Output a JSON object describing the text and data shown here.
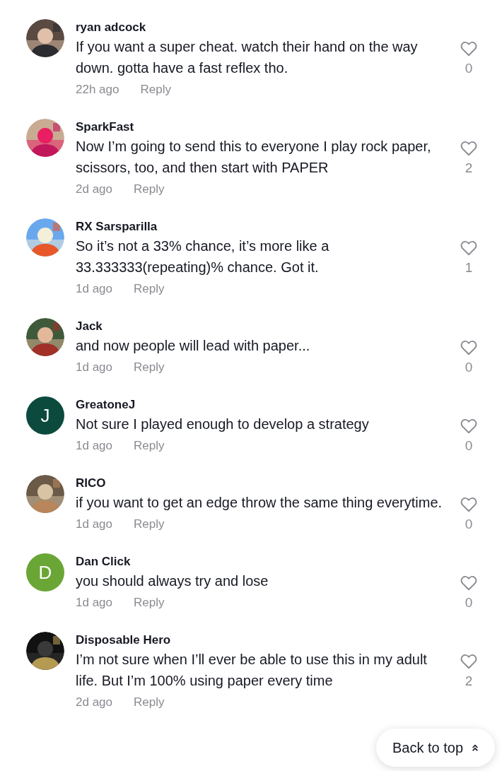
{
  "comments": [
    {
      "name": "ryan adcock",
      "text": "If you want a super cheat. watch their hand on the way down. gotta have a fast reflex tho.",
      "time": "22h ago",
      "reply": "Reply",
      "likes": "0",
      "liked": false
    },
    {
      "name": "SparkFast",
      "text": "Now I’m going to send this to everyone I play rock paper, scissors, too, and then start with PAPER",
      "time": "2d ago",
      "reply": "Reply",
      "likes": "2",
      "liked": false
    },
    {
      "name": "RX Sarsparilla",
      "text": "So it’s not a 33% chance, it’s more like a 33.333333(repeating)% chance. Got it.",
      "time": "1d ago",
      "reply": "Reply",
      "likes": "1",
      "liked": false
    },
    {
      "name": "Jack",
      "text": "and now people will lead with paper...",
      "time": "1d ago",
      "reply": "Reply",
      "likes": "0",
      "liked": false
    },
    {
      "avatar": {
        "kind": "letter",
        "letter": "J",
        "color": "#0b4a3d"
      },
      "name": "GreatoneJ",
      "text": "Not sure I played enough to develop a strategy",
      "time": "1d ago",
      "reply": "Reply",
      "likes": "0",
      "liked": false
    },
    {
      "name": "RICO",
      "text": "if you want to get an edge throw the same thing everytime.",
      "time": "1d ago",
      "reply": "Reply",
      "likes": "0",
      "liked": false
    },
    {
      "avatar": {
        "kind": "letter",
        "letter": "D",
        "color": "#6aa636"
      },
      "name": "Dan Click",
      "text": "you should always try and lose",
      "time": "1d ago",
      "reply": "Reply",
      "likes": "0",
      "liked": false
    },
    {
      "name": "Disposable Hero",
      "text": "I’m not sure when I’ll ever be able to use this in my adult life. But I’m 100% using paper every time",
      "time": "2d ago",
      "reply": "Reply",
      "likes": "2",
      "liked": false
    }
  ],
  "back_to_top": {
    "label": "Back to top"
  }
}
